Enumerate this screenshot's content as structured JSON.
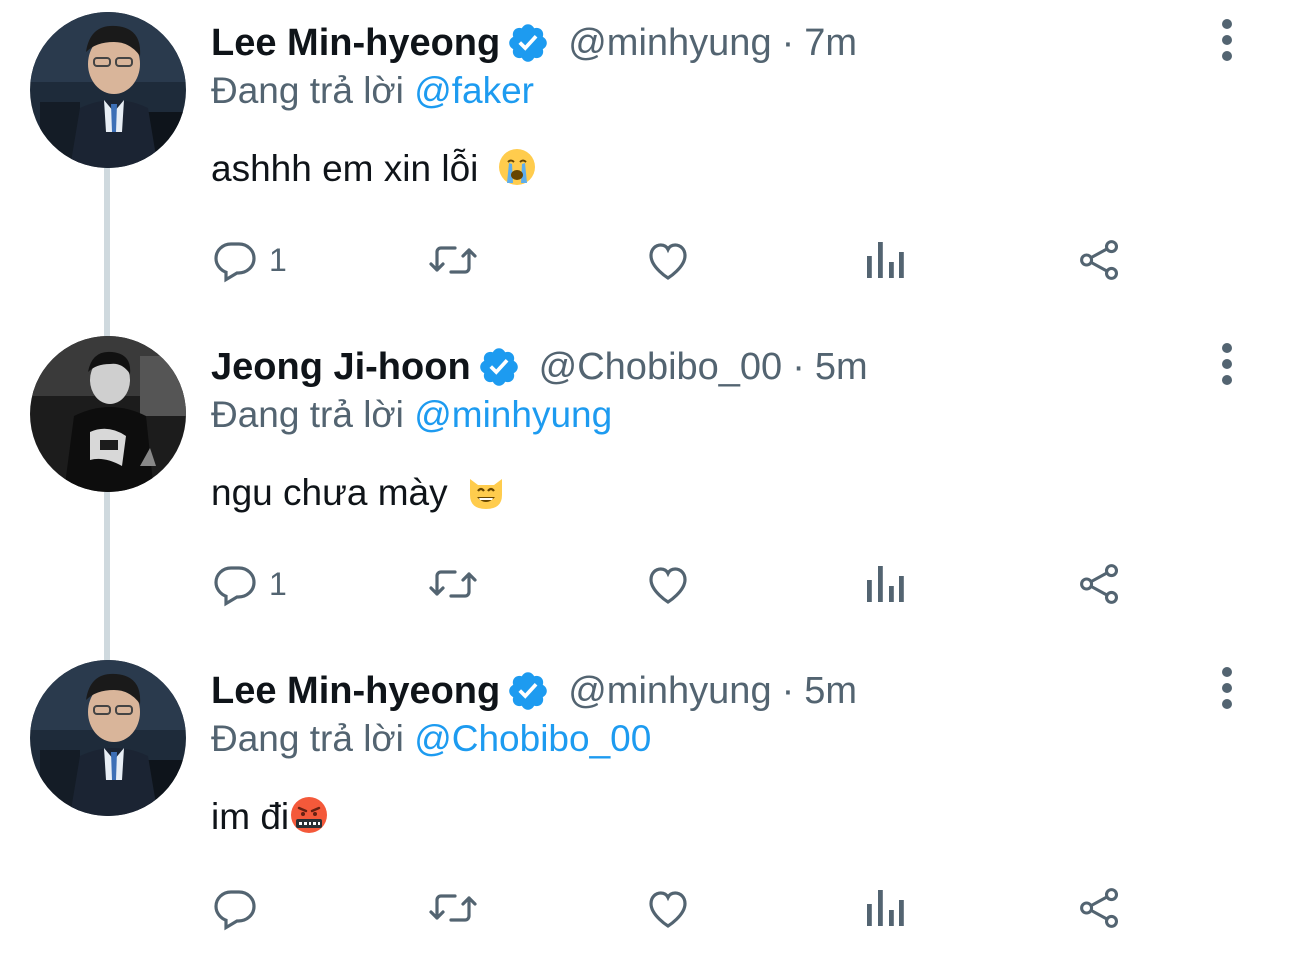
{
  "tweets": [
    {
      "author": "Lee Min-hyeong",
      "handle": "@minhyung",
      "separator": "·",
      "time": "7m",
      "replying_label": "Đang trả lời",
      "replying_to": "@faker",
      "text": "ashhh em xin lỗi",
      "emoji": "loudly-crying-face",
      "reply_count": "1",
      "avatar": "lee-min-hyeong-avatar"
    },
    {
      "author": "Jeong Ji-hoon",
      "handle": "@Chobibo_00",
      "separator": "·",
      "time": "5m",
      "replying_label": "Đang trả lời",
      "replying_to": "@minhyung",
      "text": "ngu chưa mày",
      "emoji": "grinning-cat-face",
      "reply_count": "1",
      "avatar": "jeong-ji-hoon-avatar"
    },
    {
      "author": "Lee Min-hyeong",
      "handle": "@minhyung",
      "separator": "·",
      "time": "5m",
      "replying_label": "Đang trả lời",
      "replying_to": "@Chobibo_00",
      "text": "im đi",
      "emoji": "face-with-symbols-on-mouth",
      "reply_count": "",
      "avatar": "lee-min-hyeong-avatar"
    }
  ],
  "colors": {
    "text": "#0f1419",
    "secondary": "#536471",
    "link": "#1d9bf0",
    "verified": "#1d9bf0",
    "thread_line": "#cfd9de"
  },
  "icons": [
    "reply-icon",
    "retweet-icon",
    "like-icon",
    "views-icon",
    "share-icon",
    "more-options-icon",
    "verified-badge-icon"
  ]
}
